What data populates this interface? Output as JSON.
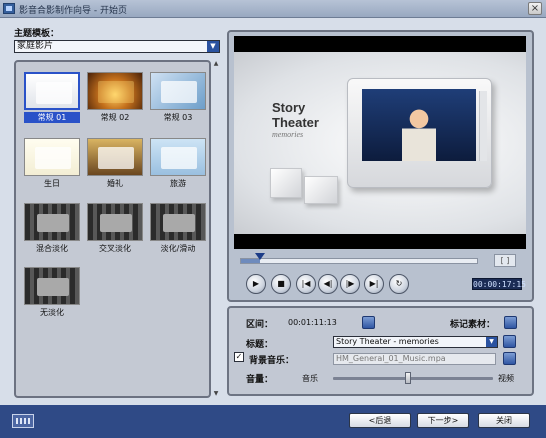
{
  "window": {
    "title": "影音合影制作向导 - 开始页",
    "close_label": "×"
  },
  "theme": {
    "label": "主题模板：",
    "selected": "家庭影片",
    "dropdown_arrow": "▼"
  },
  "thumbnails": [
    {
      "label": "常规 01",
      "icon": "photo-frame-icon",
      "selected": true
    },
    {
      "label": "常规 02",
      "icon": "sunset-frame-icon",
      "selected": false
    },
    {
      "label": "常规 03",
      "icon": "book-frame-icon",
      "selected": false
    },
    {
      "label": "生日",
      "icon": "birthday-frame-icon",
      "selected": false
    },
    {
      "label": "婚礼",
      "icon": "wedding-frame-icon",
      "selected": false
    },
    {
      "label": "旅游",
      "icon": "travel-frame-icon",
      "selected": false
    },
    {
      "label": "混合淡化",
      "icon": "film-transition-icon",
      "selected": false
    },
    {
      "label": "交叉淡化",
      "icon": "film-transition-icon",
      "selected": false
    },
    {
      "label": "淡化/滑动",
      "icon": "film-transition-icon",
      "selected": false
    },
    {
      "label": "无淡化",
      "icon": "film-transition-icon",
      "selected": false
    }
  ],
  "preview": {
    "story_line1": "Story",
    "story_line2": "Theater",
    "story_line3": "memories"
  },
  "playback": {
    "progress": 0.08,
    "timecode": "00:00:17:15",
    "bracket_label": "[ ]",
    "play": "▶",
    "stop": "■",
    "start": "|◀",
    "prev": "◀|",
    "next": "|▶",
    "end": "▶|",
    "loop": "↻"
  },
  "settings": {
    "interval_label": "区间：",
    "interval_value": "00:01:11:13",
    "marker_label": "标记素材：",
    "title_label": "标题：",
    "title_value": "Story  Theater - memories",
    "music_label": "背景音乐：",
    "music_checked": true,
    "music_check_glyph": "✓",
    "music_file": "HM_General_01_Music.mpa",
    "volume_label": "音量：",
    "volume_left": "音乐",
    "volume_right": "视频",
    "volume_level": 0.47
  },
  "footer": {
    "back": "<后退",
    "next": "下一步>",
    "close": "关闭"
  },
  "colors": {
    "accent": "#2a52c8",
    "footer_bg": "#2f4a86",
    "timecode_bg": "#1b2c55"
  }
}
